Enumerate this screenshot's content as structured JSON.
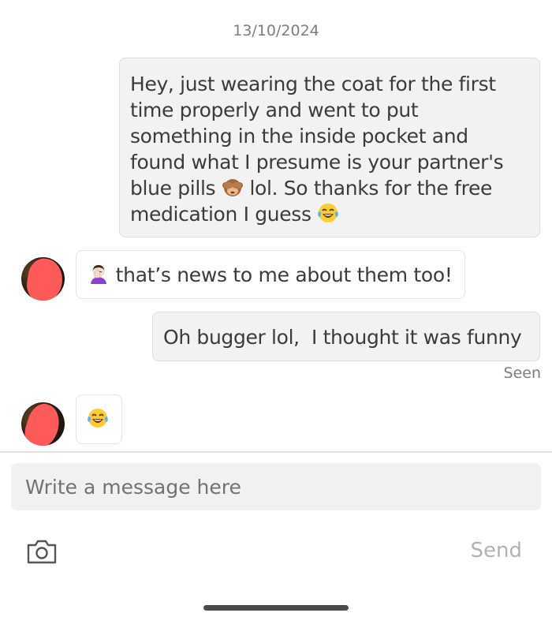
{
  "conversation": {
    "date": "13/10/2024",
    "messages": [
      {
        "sender": "me",
        "lines": [
          "Hey, just wearing the coat for the first",
          "time properly and went to put",
          "something in the inside pocket and",
          "found what I presume is your partner's",
          "blue pills",
          "lol. So thanks for the free",
          "medication I guess"
        ],
        "emojis": [
          "see-no-evil-monkey-emoji",
          "tears-of-joy-emoji"
        ]
      },
      {
        "sender": "them",
        "text": "that’s news to me about them too!",
        "emojis": [
          "woman-facepalming-emoji"
        ]
      },
      {
        "sender": "me",
        "text": "Oh bugger lol,  I thought it was funny"
      },
      {
        "sender": "them",
        "emojis": [
          "tears-of-joy-emoji"
        ]
      }
    ],
    "read_status": "Seen"
  },
  "composer": {
    "placeholder": "Write a message here",
    "camera_icon": "camera-icon",
    "send_label": "Send"
  },
  "colors": {
    "my_bubble": "#f2f2f2",
    "their_bubble": "#ffffff",
    "muted_text": "#7d7d7d",
    "send_disabled": "#b3b3b3"
  }
}
